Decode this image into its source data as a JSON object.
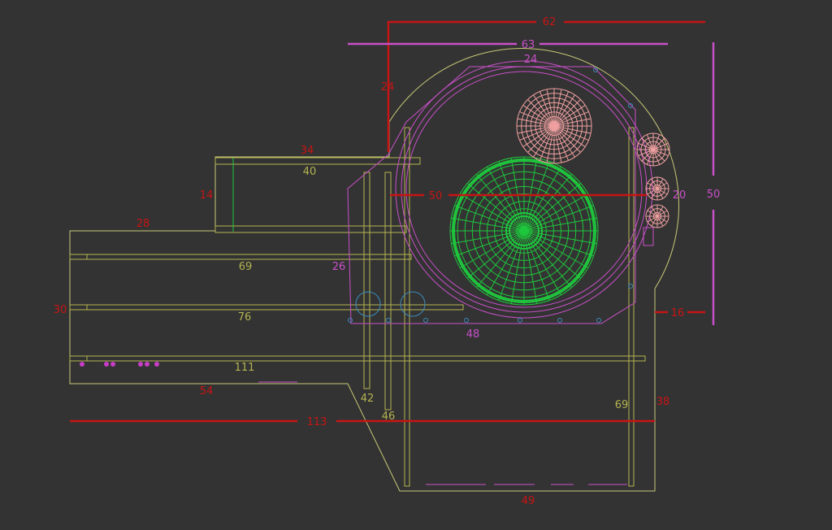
{
  "colors": {
    "background": "#333333",
    "outline": "#c8c878",
    "part": "#b4b450",
    "magenta": "#c850c8",
    "red": "#c81414",
    "green": "#1ec83c",
    "pink": "#f0a0a0",
    "cyan": "#3c8cbe"
  },
  "dimensions": {
    "d62": "62",
    "d63": "63",
    "d24_top": "24",
    "d24_left": "24",
    "d34": "34",
    "d40": "40",
    "d14": "14",
    "d28": "28",
    "d50_center": "50",
    "d20": "20",
    "d50_right": "50",
    "d69_top": "69",
    "d26": "26",
    "d30": "30",
    "d76": "76",
    "d48": "48",
    "d16": "16",
    "d111": "111",
    "d54": "54",
    "d42": "42",
    "d46": "46",
    "d69_bottom": "69",
    "d38": "38",
    "d113": "113",
    "d49": "49"
  }
}
